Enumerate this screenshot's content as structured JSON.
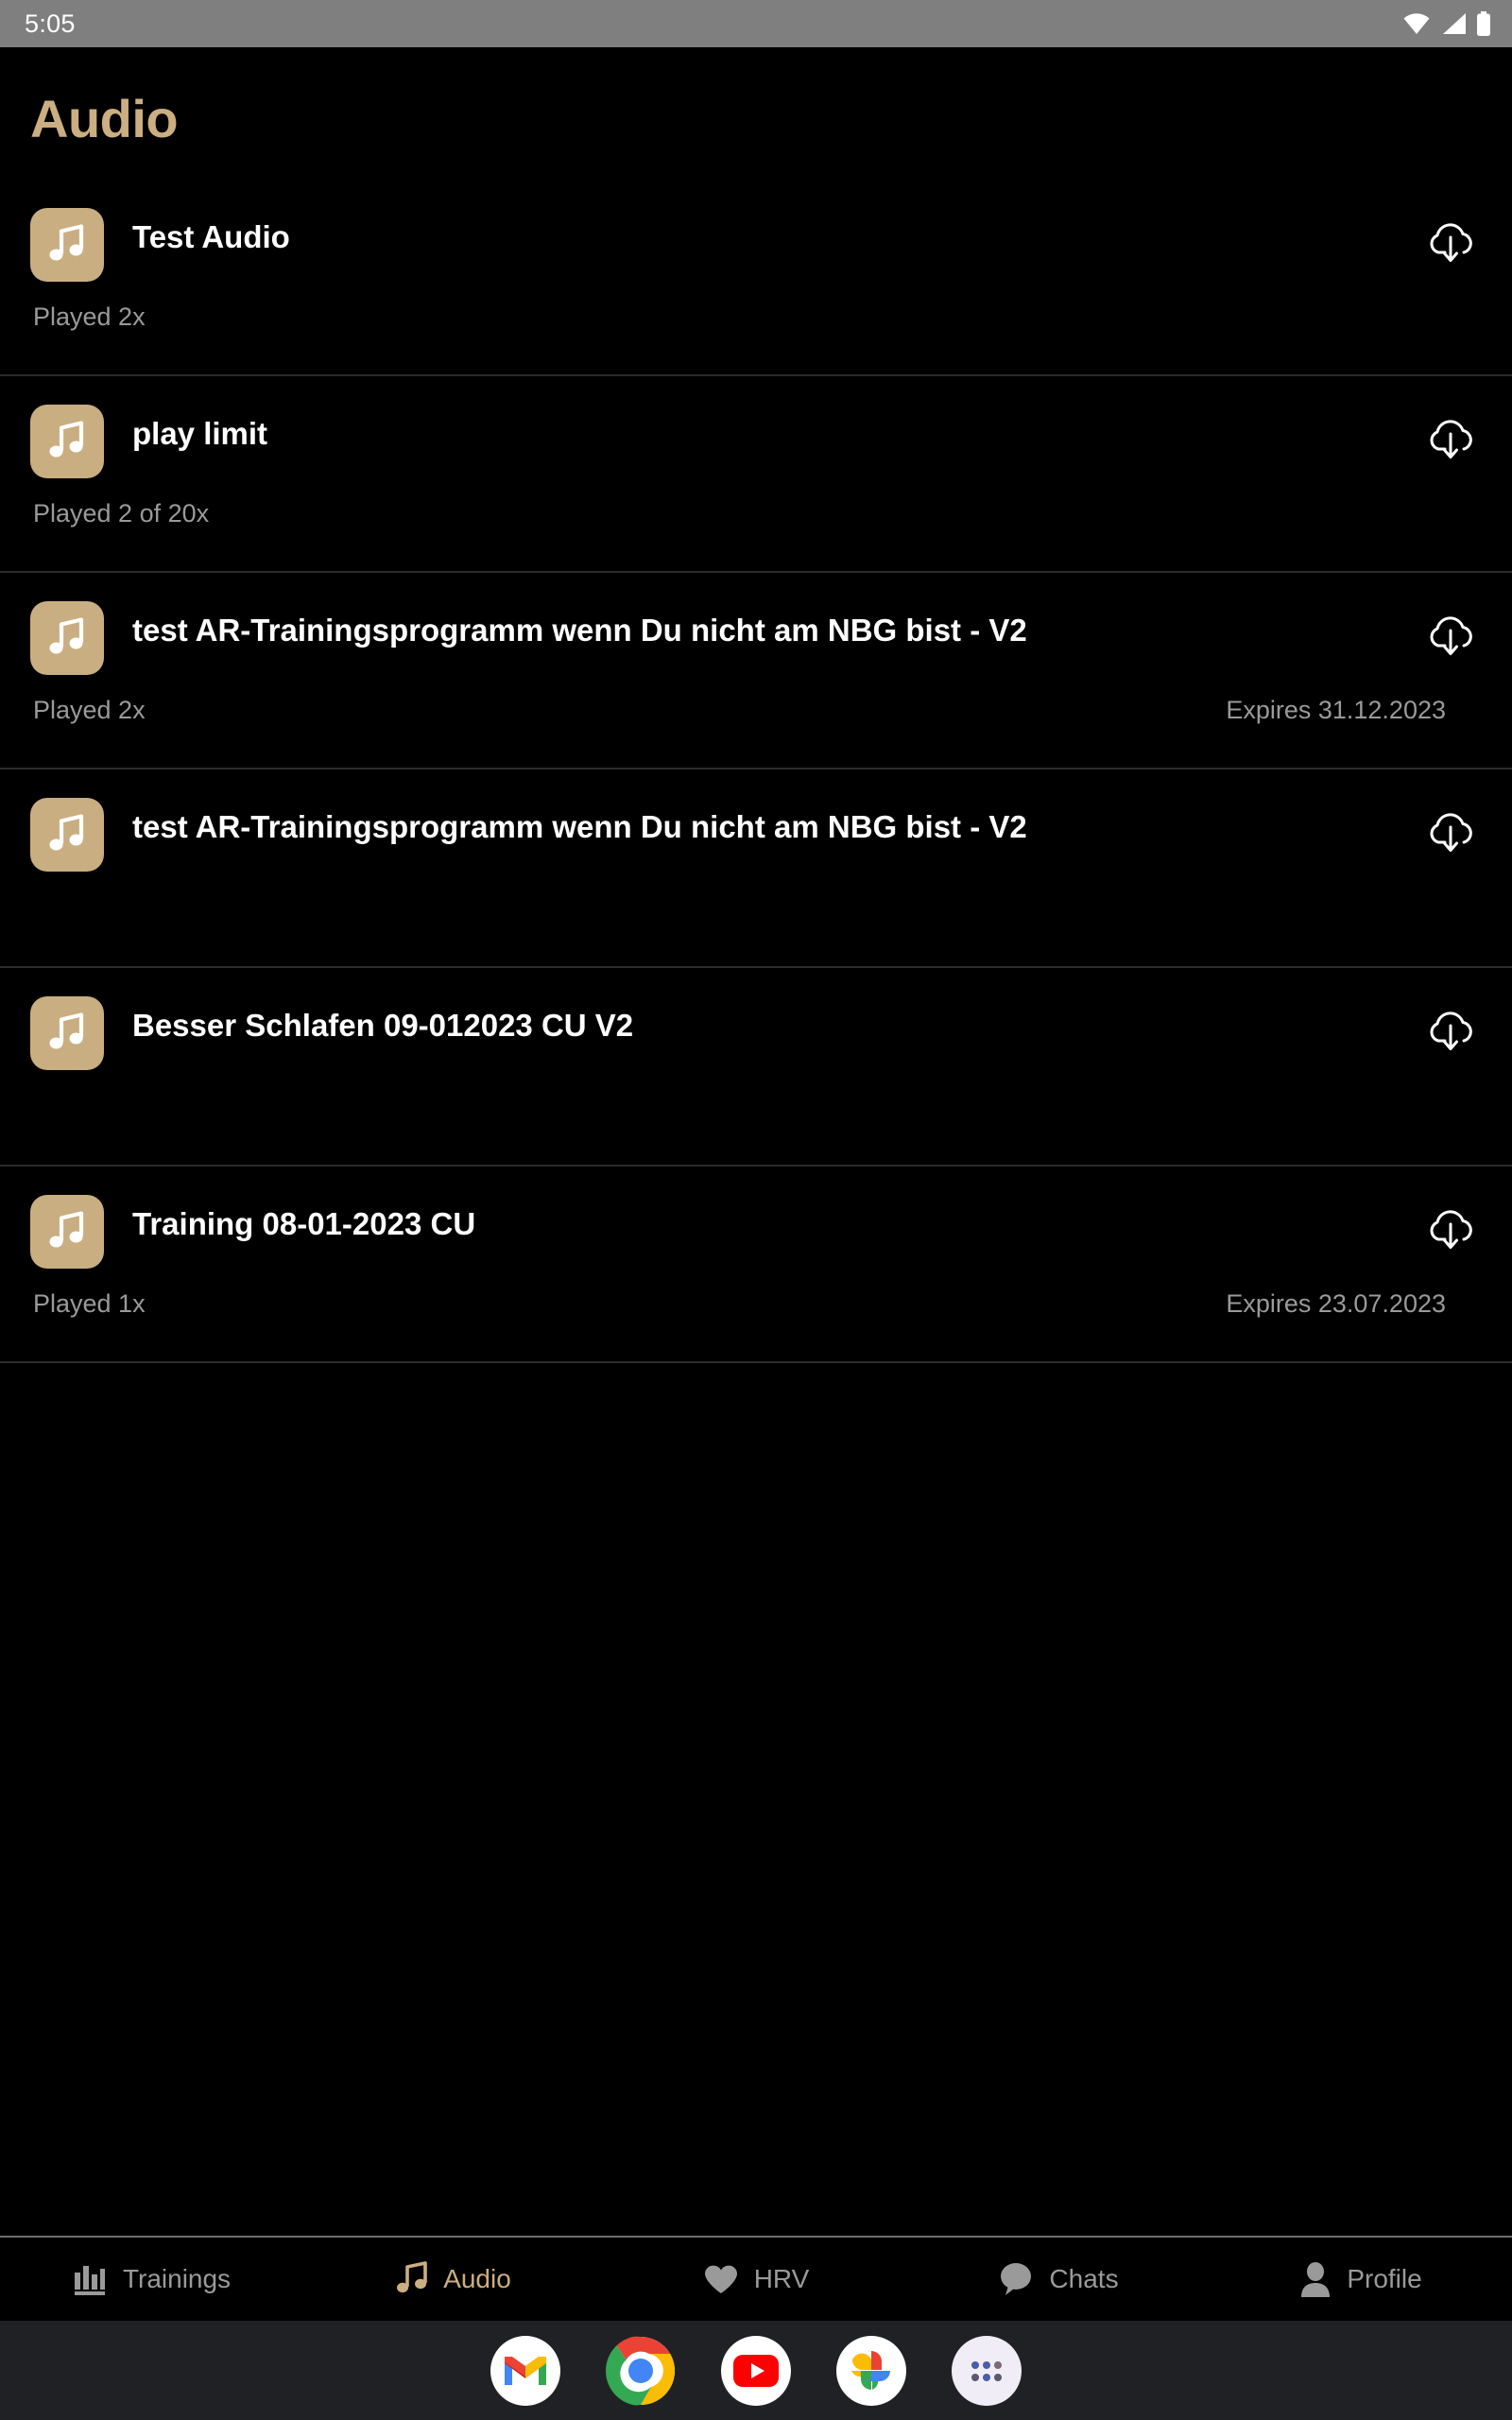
{
  "status_bar": {
    "time": "5:05",
    "icons": [
      "wifi-icon",
      "cellular-signal-icon",
      "battery-icon"
    ]
  },
  "header": {
    "title": "Audio",
    "accent_color": "#CBAE81"
  },
  "list": {
    "items": [
      {
        "title": "Test Audio",
        "played": "Played 2x",
        "expires": "",
        "thumb_icon": "music-note-icon",
        "action_icon": "cloud-download-icon"
      },
      {
        "title": "play limit",
        "played": "Played 2 of 20x",
        "expires": "",
        "thumb_icon": "music-note-icon",
        "action_icon": "cloud-download-icon"
      },
      {
        "title": "test AR-Trainingsprogramm wenn Du nicht am NBG bist - V2",
        "played": "Played 2x",
        "expires": "Expires 31.12.2023",
        "thumb_icon": "music-note-icon",
        "action_icon": "cloud-download-icon"
      },
      {
        "title": "test AR-Trainingsprogramm wenn Du nicht am NBG bist - V2",
        "played": "",
        "expires": "",
        "thumb_icon": "music-note-icon",
        "action_icon": "cloud-download-icon"
      },
      {
        "title": "Besser Schlafen 09-012023 CU V2",
        "played": "",
        "expires": "",
        "thumb_icon": "music-note-icon",
        "action_icon": "cloud-download-icon"
      },
      {
        "title": "Training 08-01-2023 CU",
        "played": "Played 1x",
        "expires": "Expires 23.07.2023",
        "thumb_icon": "music-note-icon",
        "action_icon": "cloud-download-icon"
      }
    ]
  },
  "tab_bar": {
    "active": "Audio",
    "inactive_color": "#9A9A9A",
    "active_color": "#CBAE81",
    "tabs": [
      {
        "label": "Trainings",
        "icon": "bar-chart-icon",
        "active": false
      },
      {
        "label": "Audio",
        "icon": "music-note-icon",
        "active": true
      },
      {
        "label": "HRV",
        "icon": "heart-icon",
        "active": false
      },
      {
        "label": "Chats",
        "icon": "chat-bubble-icon",
        "active": false
      },
      {
        "label": "Profile",
        "icon": "person-icon",
        "active": false
      }
    ]
  },
  "dock": {
    "apps": [
      {
        "name": "Gmail",
        "icon": "gmail-icon"
      },
      {
        "name": "Chrome",
        "icon": "chrome-icon"
      },
      {
        "name": "YouTube",
        "icon": "youtube-icon"
      },
      {
        "name": "Google Photos",
        "icon": "google-photos-icon"
      },
      {
        "name": "All apps",
        "icon": "app-drawer-icon"
      }
    ]
  }
}
